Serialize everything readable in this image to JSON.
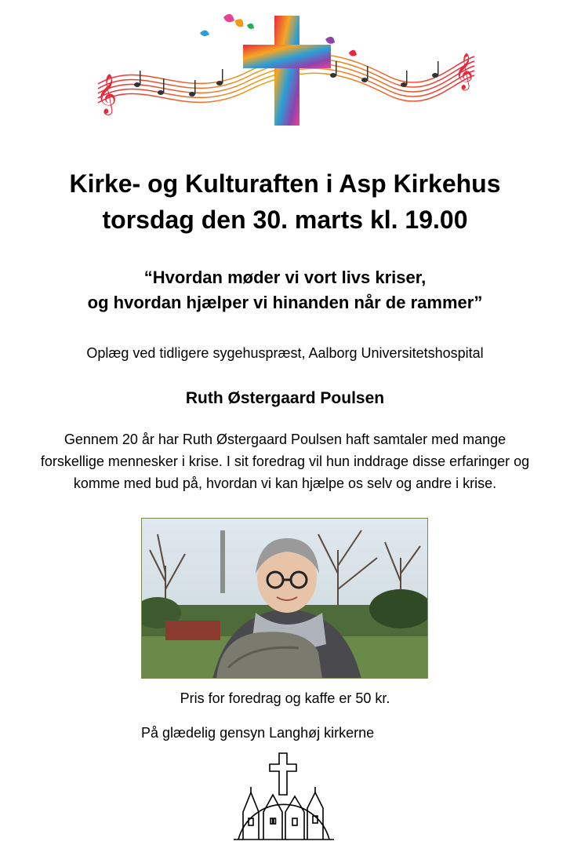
{
  "header_graphic": {
    "icon": "musical-cross-banner"
  },
  "event": {
    "title_line1": "Kirke- og Kulturaften i Asp Kirkehus",
    "title_line2": "torsdag den 30. marts kl. 19.00"
  },
  "quote": {
    "line1": "“Hvordan møder vi vort livs kriser,",
    "line2": "og hvordan hjælper vi hinanden når de rammer”"
  },
  "intro": "Oplæg ved tidligere sygehuspræst, Aalborg Universitetshospital",
  "speaker": "Ruth Østergaard Poulsen",
  "description": {
    "line1": "Gennem 20 år har Ruth Østergaard Poulsen haft samtaler med mange",
    "line2": "forskellige mennesker i krise. I sit foredrag vil hun inddrage disse erfaringer og",
    "line3": "komme med bud på, hvordan vi kan hjælpe os selv og andre i krise."
  },
  "photo": {
    "icon": "speaker-portrait-photo"
  },
  "price": "Pris for foredrag og kaffe er 50 kr.",
  "closing": "På glædelig gensyn Langhøj kirkerne",
  "logo": {
    "icon": "churches-logo-icon"
  }
}
